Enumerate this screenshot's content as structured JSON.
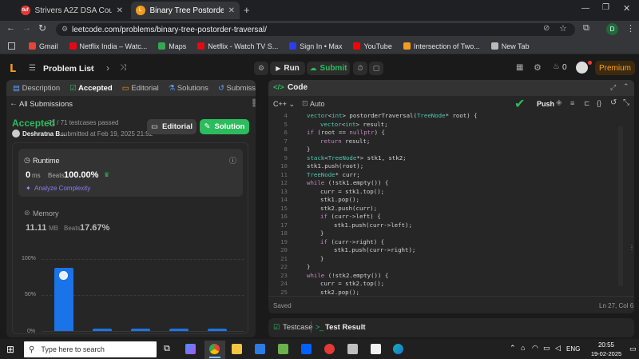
{
  "browser": {
    "tabs": [
      {
        "title": "Strivers A2Z DSA Course/Sheet",
        "active": false,
        "favicon_color": "#e53935"
      },
      {
        "title": "Binary Tree Postorder Traversal",
        "active": true,
        "favicon_color": "#f29c1f"
      }
    ],
    "url": "leetcode.com/problems/binary-tree-postorder-traversal/",
    "profile_initial": "D",
    "bookmarks": [
      {
        "label": "Gmail",
        "color": "#ea4335"
      },
      {
        "label": "Netflix India – Watc...",
        "color": "#e50914"
      },
      {
        "label": "Maps",
        "color": "#34a853"
      },
      {
        "label": "Netflix - Watch TV S...",
        "color": "#e50914"
      },
      {
        "label": "Sign In • Max",
        "color": "#2b3df5"
      },
      {
        "label": "YouTube",
        "color": "#ff0000"
      },
      {
        "label": "Intersection of Two...",
        "color": "#f29c1f"
      },
      {
        "label": "New Tab",
        "color": "#bbbbbb"
      }
    ]
  },
  "leetcode": {
    "problem_list": "Problem List",
    "run": "Run",
    "submit": "Submit",
    "streak": "0",
    "premium": "Premium"
  },
  "left": {
    "tabs": [
      "Description",
      "Accepted",
      "Editorial",
      "Solutions",
      "Submissions"
    ],
    "all_submissions": "All Submissions",
    "status": "Accepted",
    "testcases": "71 / 71 testcases passed",
    "user": "Deshratna B...",
    "submitted": "submitted at Feb 19, 2025 21:52",
    "editorial_btn": "Editorial",
    "solution_btn": "Solution",
    "runtime_label": "Runtime",
    "runtime_value": "0",
    "runtime_unit": "ms",
    "beats_label": "Beats",
    "runtime_beats": "100.00%",
    "analyze": "Analyze Complexity",
    "memory_label": "Memory",
    "memory_value": "11.11",
    "memory_unit": "MB",
    "memory_beats": "17.67%",
    "y_ticks": [
      "100%",
      "50%",
      "0%"
    ],
    "distribution": [
      0.88,
      0.03,
      0.03,
      0.03,
      0.03
    ]
  },
  "right": {
    "title": "Code",
    "language": "C++",
    "mode": "Auto",
    "push": "Push",
    "saved": "Saved",
    "cursor": "Ln 27, Col 6",
    "code_lines": [
      {
        "n": "4",
        "indent": 0,
        "t": "vector<int> postorderTraversal(TreeNode* root) {"
      },
      {
        "n": "5",
        "indent": 1,
        "t": "vector<int> result;"
      },
      {
        "n": "6",
        "indent": 0,
        "t": "if (root == nullptr) {"
      },
      {
        "n": "7",
        "indent": 1,
        "t": "return result;"
      },
      {
        "n": "8",
        "indent": 0,
        "t": "}"
      },
      {
        "n": "9",
        "indent": 0,
        "t": "stack<TreeNode*> stk1, stk2;"
      },
      {
        "n": "10",
        "indent": 0,
        "t": "stk1.push(root);"
      },
      {
        "n": "11",
        "indent": 0,
        "t": "TreeNode* curr;"
      },
      {
        "n": "12",
        "indent": 0,
        "t": "while (!stk1.empty()) {"
      },
      {
        "n": "13",
        "indent": 1,
        "t": "curr = stk1.top();"
      },
      {
        "n": "14",
        "indent": 1,
        "t": "stk1.pop();"
      },
      {
        "n": "15",
        "indent": 1,
        "t": "stk2.push(curr);"
      },
      {
        "n": "16",
        "indent": 1,
        "t": "if (curr->left) {"
      },
      {
        "n": "17",
        "indent": 2,
        "t": "stk1.push(curr->left);"
      },
      {
        "n": "18",
        "indent": 1,
        "t": "}"
      },
      {
        "n": "19",
        "indent": 1,
        "t": "if (curr->right) {"
      },
      {
        "n": "20",
        "indent": 2,
        "t": "stk1.push(curr->right);"
      },
      {
        "n": "21",
        "indent": 1,
        "t": "}"
      },
      {
        "n": "22",
        "indent": 0,
        "t": "}"
      },
      {
        "n": "23",
        "indent": 0,
        "t": "while (!stk2.empty()) {"
      },
      {
        "n": "24",
        "indent": 1,
        "t": "curr = stk2.top();"
      },
      {
        "n": "25",
        "indent": 1,
        "t": "stk2.pop();"
      }
    ]
  },
  "bottom": {
    "testcase": "Testcase",
    "test_result": "Test Result"
  },
  "taskbar": {
    "search": "Type here to search",
    "lang": "ENG",
    "time": "20:55",
    "date": "19-02-2025"
  }
}
